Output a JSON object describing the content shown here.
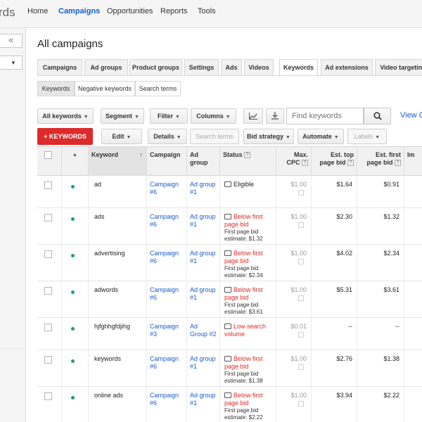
{
  "brand": "rds",
  "nav": [
    "Home",
    "Campaigns",
    "Opportunities",
    "Reports",
    "Tools"
  ],
  "page_title": "All campaigns",
  "tabs": [
    "Campaigns",
    "Ad groups",
    "Product groups",
    "Settings",
    "Ads",
    "Videos",
    "Keywords",
    "Ad extensions",
    "Video targeting"
  ],
  "active_tab": "Keywords",
  "subtabs": [
    "Keywords",
    "Negative keywords",
    "Search terms"
  ],
  "toolbar1": {
    "all_keywords": "All keywords",
    "segment": "Segment",
    "filter": "Filter",
    "columns": "Columns",
    "search_placeholder": "Find keywords",
    "view_link": "View C"
  },
  "toolbar2": {
    "add_keywords": "+ KEYWORDS",
    "edit": "Edit",
    "details": "Details",
    "search_terms": "Search terms",
    "bid_strategy": "Bid strategy",
    "automate": "Automate",
    "labels": "Labels"
  },
  "columns": {
    "keyword": "Keyword",
    "campaign": "Campaign",
    "ad_group": "Ad group",
    "status": "Status",
    "max_cpc": "Max. CPC",
    "est_top": "Est. top page bid",
    "est_first": "Est. first page bid",
    "impr": "Im"
  },
  "rows": [
    {
      "keyword": "ad",
      "campaign": "Campaign #6",
      "ad_group": "Ad group #1",
      "status": "Eligible",
      "status_type": "ok",
      "status_detail": "",
      "max_cpc": "$1.00",
      "est_top": "$1.64",
      "est_first": "$0.91"
    },
    {
      "keyword": "ads",
      "campaign": "Campaign #6",
      "ad_group": "Ad group #1",
      "status": "Below first page bid",
      "status_type": "warn",
      "status_detail": "First page bid estimate: $1.32",
      "max_cpc": "$1.00",
      "est_top": "$2.30",
      "est_first": "$1.32"
    },
    {
      "keyword": "advertising",
      "campaign": "Campaign #6",
      "ad_group": "Ad group #1",
      "status": "Below first page bid",
      "status_type": "warn",
      "status_detail": "First page bid estimate: $2.34",
      "max_cpc": "$1.00",
      "est_top": "$4.02",
      "est_first": "$2.34"
    },
    {
      "keyword": "adwords",
      "campaign": "Campaign #6",
      "ad_group": "Ad group #1",
      "status": "Below first page bid",
      "status_type": "warn",
      "status_detail": "First page bid estimate: $3.61",
      "max_cpc": "$1.00",
      "est_top": "$5.31",
      "est_first": "$3.61"
    },
    {
      "keyword": "hjfghhgfdjihg",
      "campaign": "Campaign #3",
      "ad_group": "Ad Group #2",
      "status": "Low search volume",
      "status_type": "warn",
      "status_detail": "",
      "max_cpc": "$0.01",
      "est_top": "--",
      "est_first": "--"
    },
    {
      "keyword": "keywords",
      "campaign": "Campaign #6",
      "ad_group": "Ad group #1",
      "status": "Below first page bid",
      "status_type": "warn",
      "status_detail": "First page bid estimate: $1.38",
      "max_cpc": "$1.00",
      "est_top": "$2.76",
      "est_first": "$1.38"
    },
    {
      "keyword": "online ads",
      "campaign": "Campaign #6",
      "ad_group": "Ad group #1",
      "status": "Below first page bid",
      "status_type": "warn",
      "status_detail": "First page bid estimate: $2.22",
      "max_cpc": "$1.00",
      "est_top": "$3.94",
      "est_first": "$2.22"
    }
  ]
}
